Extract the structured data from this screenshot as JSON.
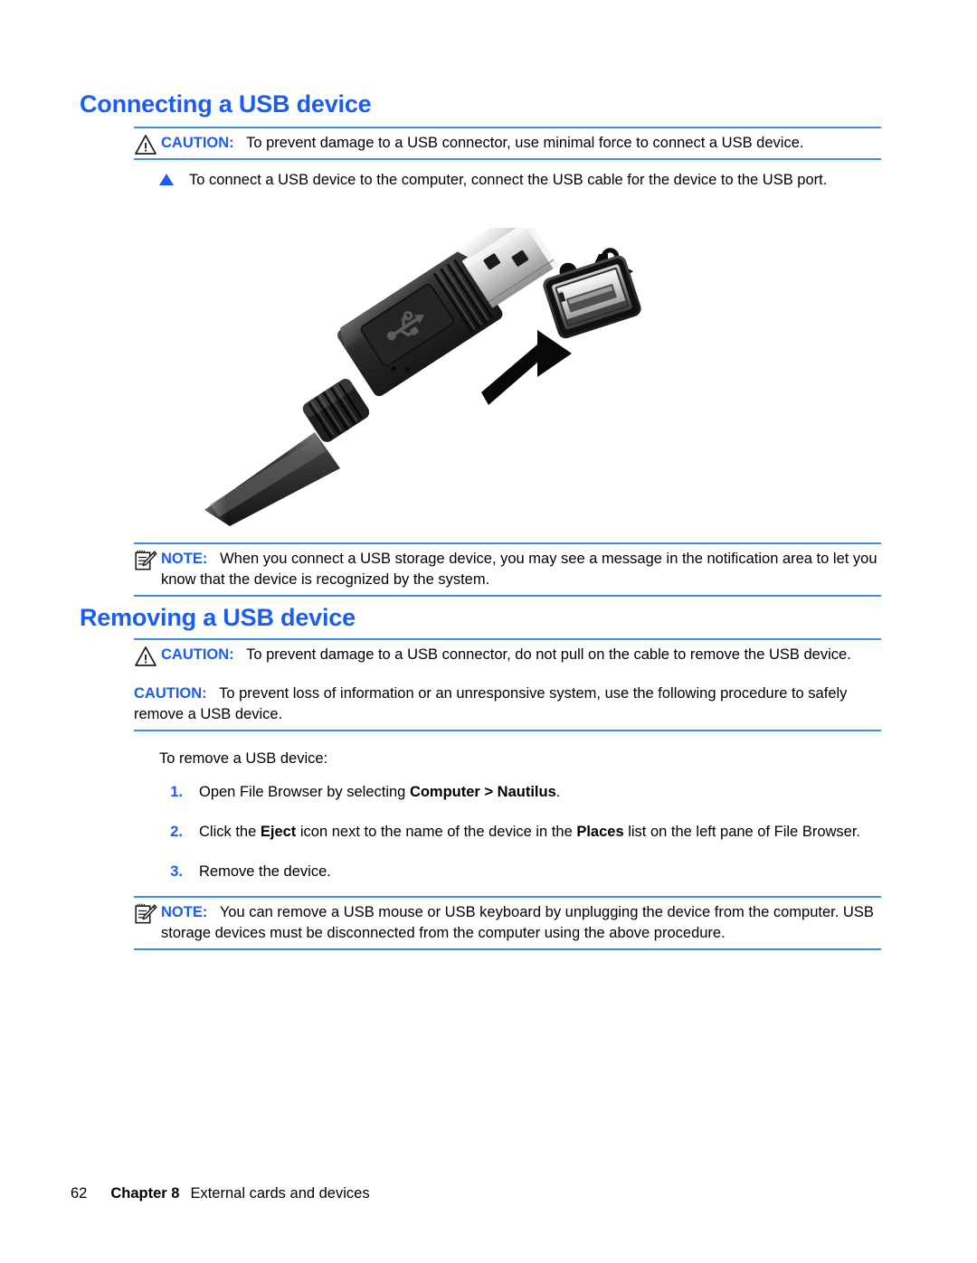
{
  "document": {
    "section1": {
      "heading": "Connecting a USB device",
      "caution": {
        "label": "CAUTION:",
        "text": "To prevent damage to a USB connector, use minimal force to connect a USB device.",
        "icon": "warning-triangle-icon"
      },
      "bullet": {
        "marker": "triangle-bullet-icon",
        "text": "To connect a USB device to the computer, connect the USB cable for the device to the USB port."
      },
      "figure": {
        "name": "usb-cable-and-port-illustration",
        "parts": [
          "usb-a-plug",
          "usb-port",
          "usb-trident-symbol",
          "insertion-arrow",
          "cable"
        ]
      },
      "note": {
        "label": "NOTE:",
        "text": "When you connect a USB storage device, you may see a message in the notification area to let you know that the device is recognized by the system.",
        "icon": "note-pad-pencil-icon"
      }
    },
    "section2": {
      "heading": "Removing a USB device",
      "caution1": {
        "label": "CAUTION:",
        "text": "To prevent damage to a USB connector, do not pull on the cable to remove the USB device.",
        "icon": "warning-triangle-icon"
      },
      "caution2": {
        "label": "CAUTION:",
        "text": "To prevent loss of information or an unresponsive system, use the following procedure to safely remove a USB device."
      },
      "intro": "To remove a USB device:",
      "steps": [
        {
          "number": "1.",
          "parts": [
            {
              "text": "Open File Browser by selecting ",
              "bold": false
            },
            {
              "text": "Computer > Nautilus",
              "bold": true
            },
            {
              "text": ".",
              "bold": false
            }
          ]
        },
        {
          "number": "2.",
          "parts": [
            {
              "text": "Click the ",
              "bold": false
            },
            {
              "text": "Eject",
              "bold": true
            },
            {
              "text": " icon next to the name of the device in the ",
              "bold": false
            },
            {
              "text": "Places",
              "bold": true
            },
            {
              "text": " list on the left pane of File Browser.",
              "bold": false
            }
          ]
        },
        {
          "number": "3.",
          "parts": [
            {
              "text": "Remove the device.",
              "bold": false
            }
          ]
        }
      ],
      "note": {
        "label": "NOTE:",
        "text": "You can remove a USB mouse or USB keyboard by unplugging the device from the computer. USB storage devices must be disconnected from the computer using the above procedure.",
        "icon": "note-pad-pencil-icon"
      }
    },
    "footer": {
      "page_number": "62",
      "chapter": "Chapter 8",
      "chapter_title": "External cards and devices"
    },
    "colors": {
      "heading_blue": "#1a5df0",
      "rule_blue": "#3f8fe0",
      "label_blue": "#1a5df0",
      "text_black": "#000000"
    }
  }
}
